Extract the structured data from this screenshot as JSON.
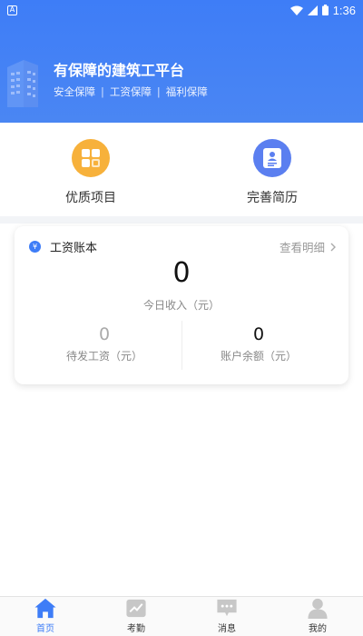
{
  "statusbar": {
    "notification_icon": "A",
    "time": "1:36"
  },
  "header": {
    "title": "有保障的建筑工平台",
    "tags": [
      "安全保障",
      "工资保障",
      "福利保障"
    ]
  },
  "quick": [
    {
      "label": "优质项目",
      "icon": "grid-icon",
      "color": "#f7b13b"
    },
    {
      "label": "完善简历",
      "icon": "resume-icon",
      "color": "#5b7ff0"
    }
  ],
  "salary": {
    "title": "工资账本",
    "link": "查看明细",
    "today_value": "0",
    "today_label": "今日收入（元）",
    "pending_value": "0",
    "pending_label": "待发工资（元）",
    "balance_value": "0",
    "balance_label": "账户余额（元）"
  },
  "tabs": [
    {
      "label": "首页",
      "icon": "home-icon",
      "active": true
    },
    {
      "label": "考勤",
      "icon": "chart-icon",
      "active": false
    },
    {
      "label": "消息",
      "icon": "message-icon",
      "active": false
    },
    {
      "label": "我的",
      "icon": "profile-icon",
      "active": false
    }
  ],
  "colors": {
    "primary": "#3e7df7",
    "accent_orange": "#f7b13b",
    "accent_blue": "#5b7ff0"
  }
}
